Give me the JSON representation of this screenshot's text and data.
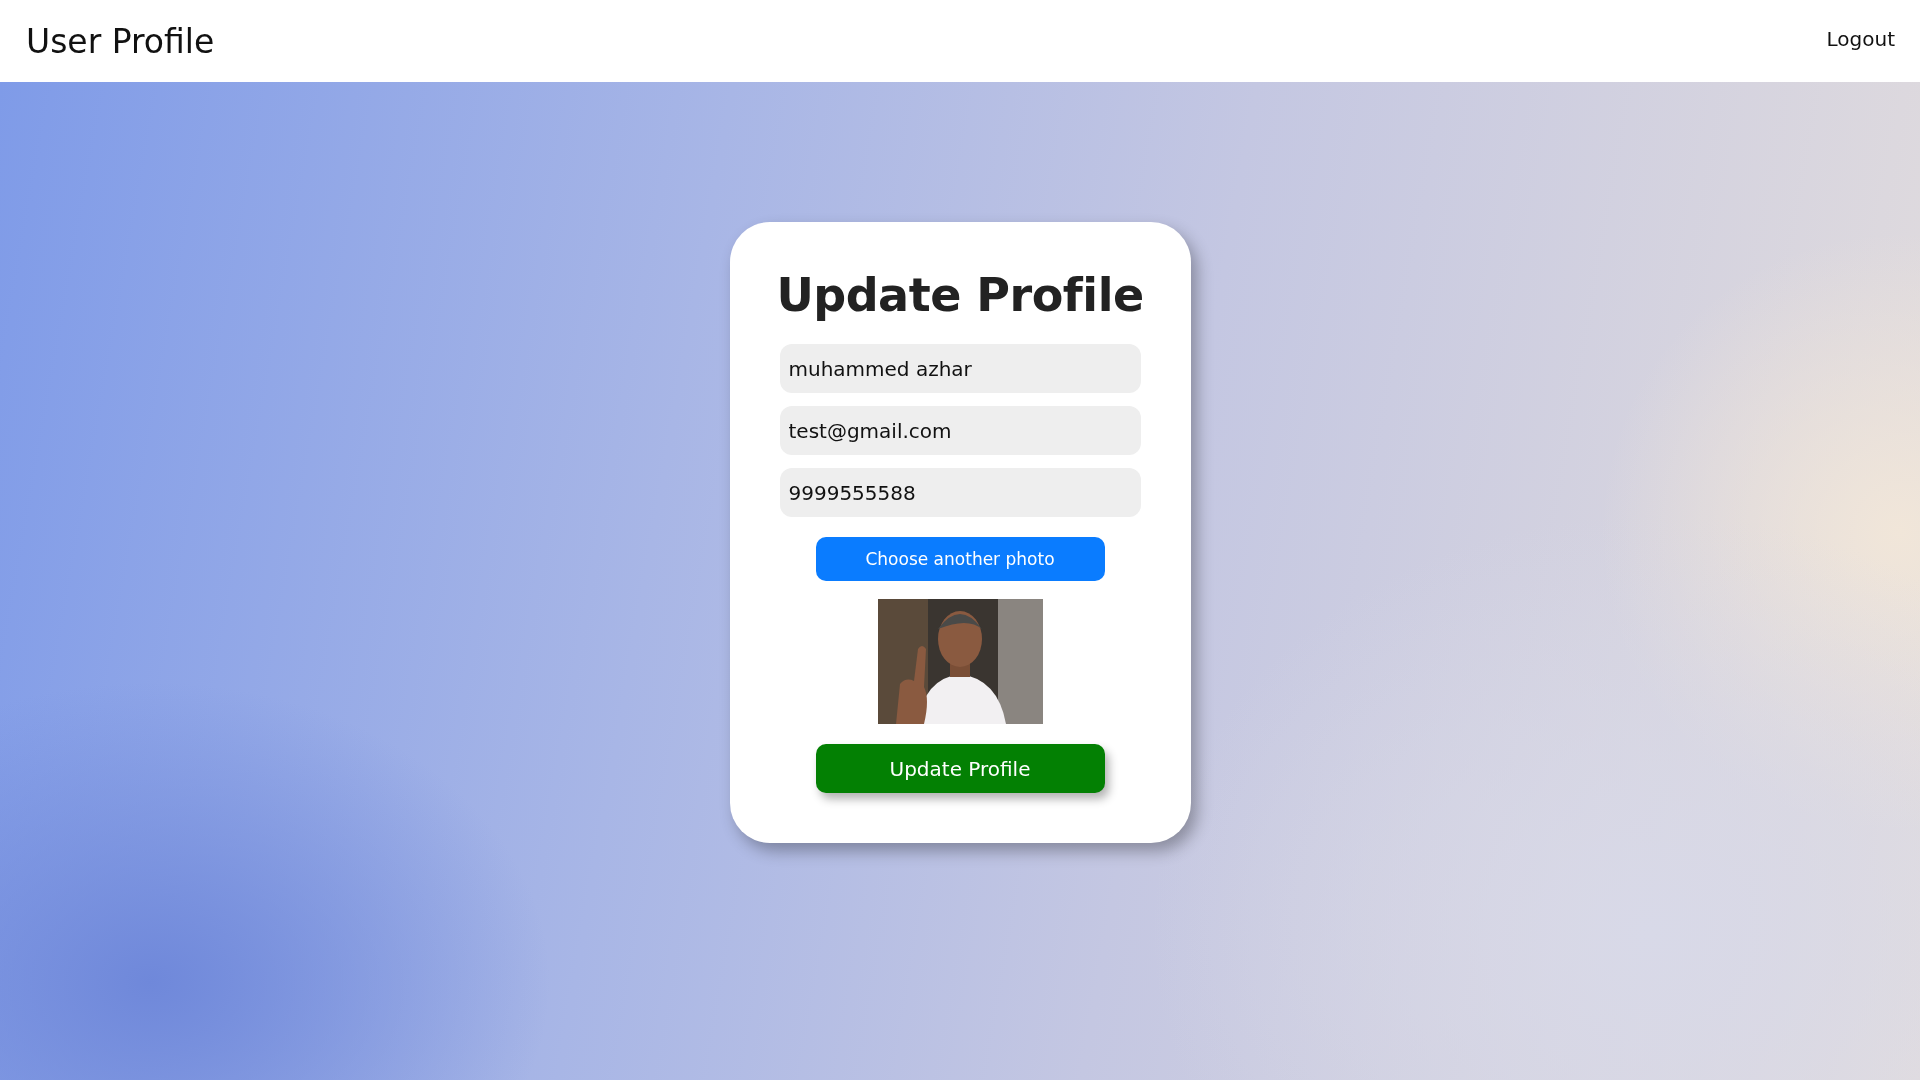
{
  "header": {
    "title": "User Profile",
    "logout": "Logout"
  },
  "form": {
    "heading": "Update Profile",
    "fields": [
      {
        "value": "muhammed azhar"
      },
      {
        "value": "test@gmail.com"
      },
      {
        "value": "9999555588"
      }
    ],
    "photo_button": "Choose another photo",
    "submit": "Update Profile"
  }
}
